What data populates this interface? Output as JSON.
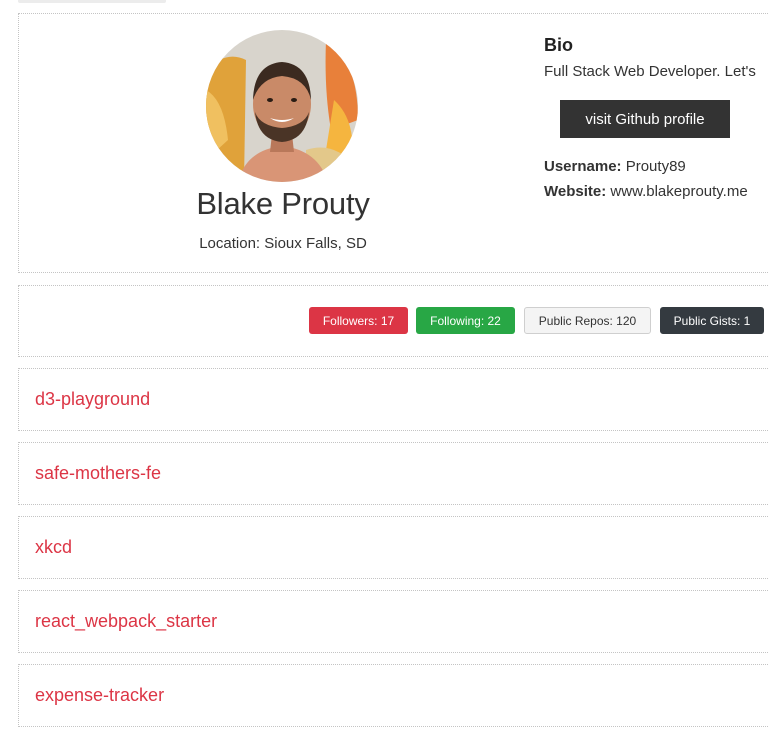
{
  "profile": {
    "name": "Blake Prouty",
    "location": "Location: Sioux Falls, SD",
    "bio_heading": "Bio",
    "bio_text": "Full Stack Web Developer. Let's",
    "github_button": "visit Github profile",
    "username_label": "Username:",
    "username_value": "Prouty89",
    "website_label": "Website:",
    "website_value": "www.blakeprouty.me"
  },
  "badges": {
    "followers": "Followers: 17",
    "following": "Following: 22",
    "repos": "Public Repos: 120",
    "gists": "Public Gists: 1"
  },
  "repos": [
    {
      "name": "d3-playground"
    },
    {
      "name": "safe-mothers-fe"
    },
    {
      "name": "xkcd"
    },
    {
      "name": "react_webpack_starter"
    },
    {
      "name": "expense-tracker"
    }
  ],
  "colors": {
    "danger": "#dc3545",
    "success": "#28a745",
    "light": "#f4f4f4",
    "dark": "#343a40",
    "button": "#333333"
  }
}
